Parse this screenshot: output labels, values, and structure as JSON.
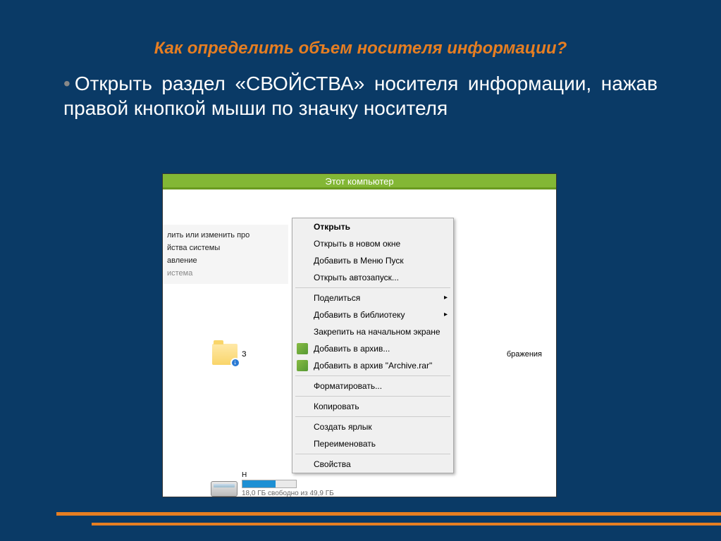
{
  "slide": {
    "title": "Как определить объем носителя информации?",
    "body": "Открыть раздел «СВОЙСТВА» носителя информации, нажав правой кнопкой мыши по значку носителя"
  },
  "window": {
    "titlebar": "Этот компьютер",
    "sidebar": {
      "row1": "лить или изменить про",
      "row2": "йства системы",
      "row3": "авление",
      "row4": "истема"
    },
    "folder_trunc": "З",
    "label_right": "бражения",
    "drive_letter": "Н",
    "drive_status": "18,0 ГБ свободно из 49,9 ГБ"
  },
  "context_menu": {
    "items": [
      {
        "label": "Открыть",
        "bold": true
      },
      {
        "label": "Открыть в новом окне"
      },
      {
        "label": "Добавить в Меню Пуск"
      },
      {
        "label": "Открыть автозапуск..."
      },
      {
        "sep": true
      },
      {
        "label": "Поделиться",
        "submenu": true
      },
      {
        "label": "Добавить в библиотеку",
        "submenu": true
      },
      {
        "label": "Закрепить на начальном экране"
      },
      {
        "label": "Добавить в архив...",
        "icon": true
      },
      {
        "label": "Добавить в архив \"Archive.rar\"",
        "icon": true
      },
      {
        "sep": true
      },
      {
        "label": "Форматировать..."
      },
      {
        "sep": true
      },
      {
        "label": "Копировать"
      },
      {
        "sep": true
      },
      {
        "label": "Создать ярлык"
      },
      {
        "label": "Переименовать"
      },
      {
        "sep": true
      },
      {
        "label": "Свойства"
      }
    ]
  }
}
